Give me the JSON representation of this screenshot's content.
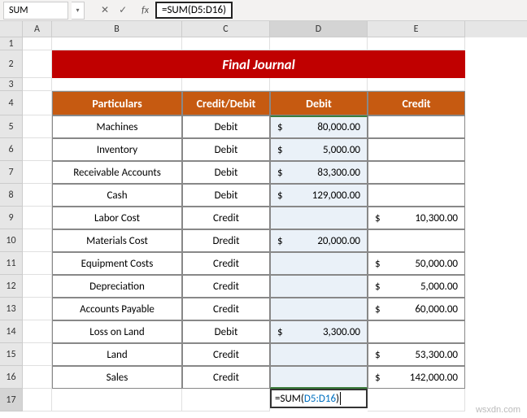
{
  "name_box": "SUM",
  "formula_bar": "=SUM(D5:D16)",
  "columns": [
    "A",
    "B",
    "C",
    "D",
    "E"
  ],
  "title": "Final Journal",
  "headers": {
    "particulars": "Particulars",
    "cd": "Credit/Debit",
    "debit": "Debit",
    "credit": "Credit"
  },
  "rows": [
    {
      "p": "Machines",
      "cd": "Debit",
      "d": "80,000.00",
      "c": ""
    },
    {
      "p": "Inventory",
      "cd": "Debit",
      "d": "5,000.00",
      "c": ""
    },
    {
      "p": "Receivable Accounts",
      "cd": "Debit",
      "d": "83,300.00",
      "c": ""
    },
    {
      "p": "Cash",
      "cd": "Debit",
      "d": "129,000.00",
      "c": ""
    },
    {
      "p": "Labor Cost",
      "cd": "Credit",
      "d": "",
      "c": "10,300.00"
    },
    {
      "p": "Materials Cost",
      "cd": "Dredit",
      "d": "20,000.00",
      "c": ""
    },
    {
      "p": "Equipment Costs",
      "cd": "Credit",
      "d": "",
      "c": "50,000.00"
    },
    {
      "p": "Depreciation",
      "cd": "Credit",
      "d": "",
      "c": "5,000.00"
    },
    {
      "p": "Accounts Payable",
      "cd": "Credit",
      "d": "",
      "c": "60,000.00"
    },
    {
      "p": "Loss on Land",
      "cd": "Debit",
      "d": "3,300.00",
      "c": ""
    },
    {
      "p": "Land",
      "cd": "Credit",
      "d": "",
      "c": "53,300.00"
    },
    {
      "p": "Sales",
      "cd": "Credit",
      "d": "",
      "c": "142,000.00"
    }
  ],
  "editing_formula_prefix": "=SUM(",
  "editing_formula_range": "D5:D16",
  "editing_formula_suffix": ")",
  "dollar": "$",
  "watermark": "wsxdn.com",
  "icons": {
    "cancel": "✕",
    "confirm": "✓",
    "dropdown": "▾"
  },
  "fx": "fx",
  "chart_data": {
    "type": "table",
    "title": "Final Journal",
    "columns": [
      "Particulars",
      "Credit/Debit",
      "Debit",
      "Credit"
    ],
    "data": [
      [
        "Machines",
        "Debit",
        80000.0,
        null
      ],
      [
        "Inventory",
        "Debit",
        5000.0,
        null
      ],
      [
        "Receivable Accounts",
        "Debit",
        83300.0,
        null
      ],
      [
        "Cash",
        "Debit",
        129000.0,
        null
      ],
      [
        "Labor Cost",
        "Credit",
        null,
        10300.0
      ],
      [
        "Materials Cost",
        "Dredit",
        20000.0,
        null
      ],
      [
        "Equipment Costs",
        "Credit",
        null,
        50000.0
      ],
      [
        "Depreciation",
        "Credit",
        null,
        5000.0
      ],
      [
        "Accounts Payable",
        "Credit",
        null,
        60000.0
      ],
      [
        "Loss on Land",
        "Debit",
        3300.0,
        null
      ],
      [
        "Land",
        "Credit",
        null,
        53300.0
      ],
      [
        "Sales",
        "Credit",
        null,
        142000.0
      ]
    ]
  }
}
